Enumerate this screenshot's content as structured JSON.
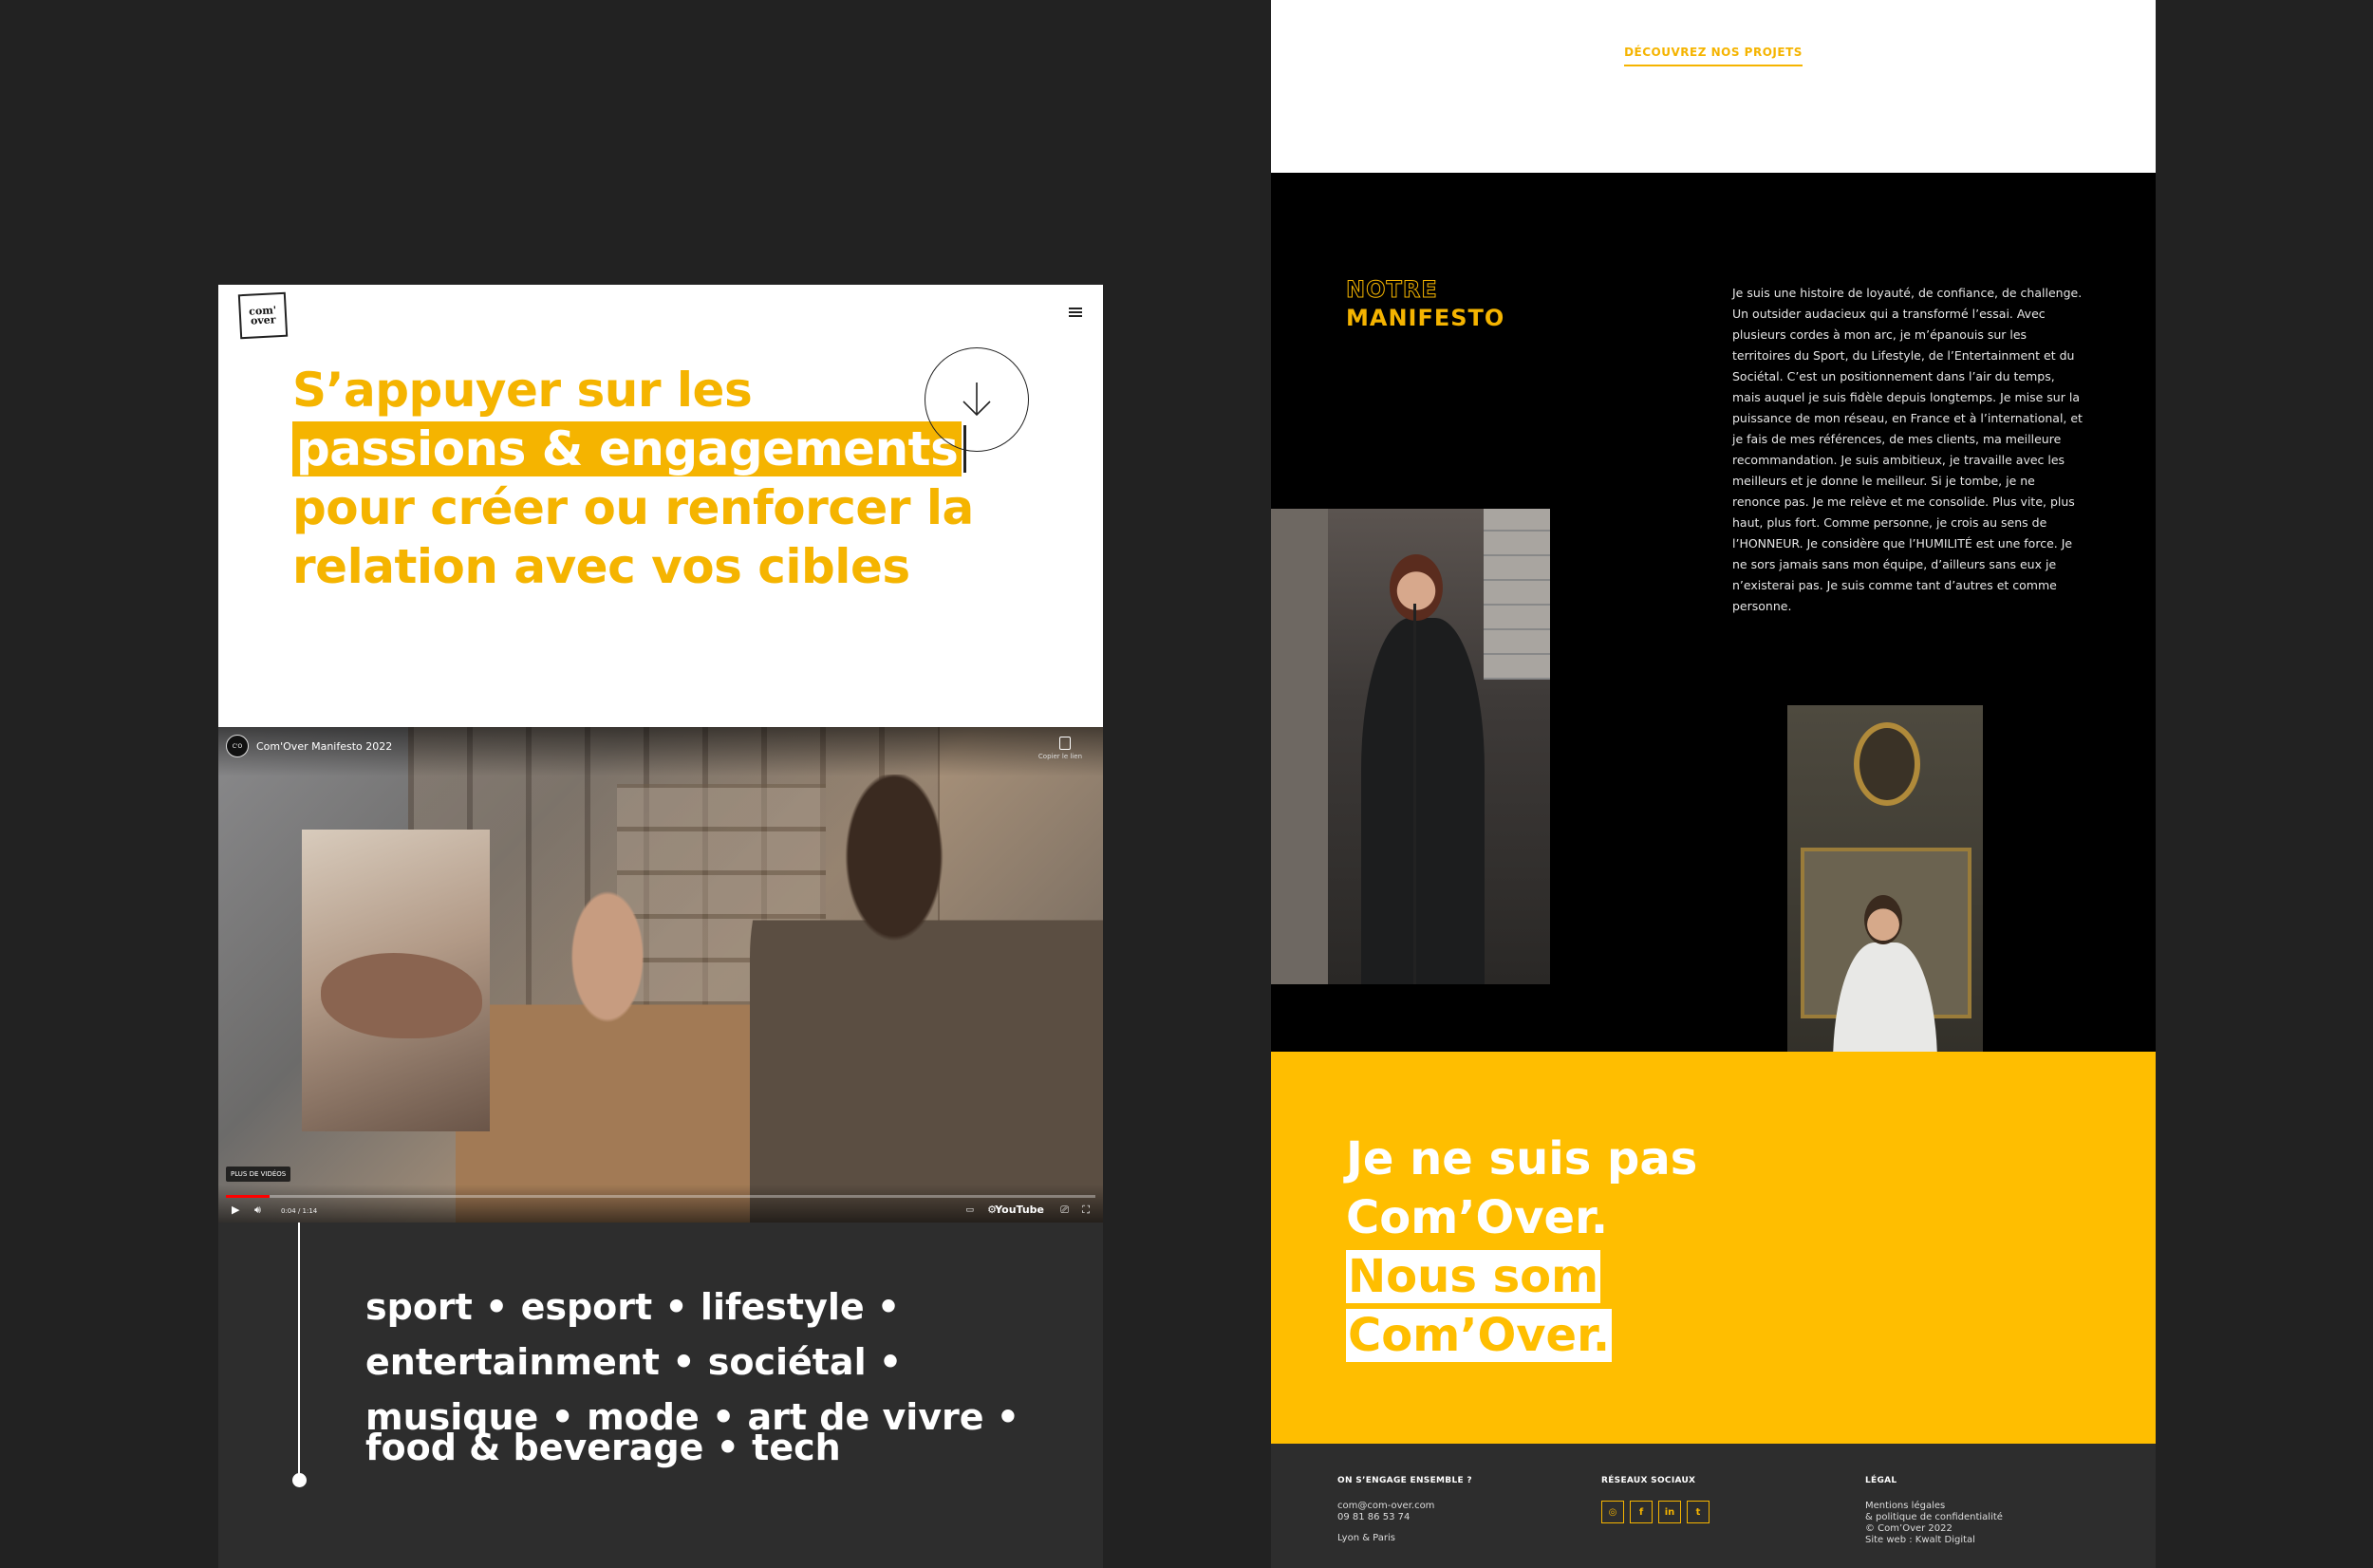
{
  "left_panel": {
    "logo_text": "com' over",
    "hero": {
      "line1": "S’appuyer sur les",
      "line2_highlight": "passions & engagements",
      "line3": "pour créer ou renforcer la",
      "line4": "relation avec vos cibles"
    },
    "video": {
      "channel_initials": "C'O",
      "title": "Com'Over Manifesto 2022",
      "copy_label": "Copier le lien",
      "more_videos": "PLUS DE VIDÉOS",
      "time": "0:04 / 1:14",
      "progress": 0.05,
      "youtube_label": "YouTube"
    },
    "tags": {
      "line1": "sport • esport • lifestyle •",
      "line2": "entertainment • sociétal •",
      "line3": "musique • mode • art de vivre •",
      "line4": "food & beverage • tech"
    }
  },
  "right_panel": {
    "discover_link": "DÉCOUVREZ NOS PROJETS",
    "manifesto": {
      "title_outline": "NOTRE",
      "title_fill": "MANIFESTO",
      "text": "Je suis une histoire de loyauté, de confiance, de challenge. Un outsider audacieux qui a transformé l’essai. Avec plusieurs cordes à mon arc, je m’épanouis sur les territoires du Sport, du Lifestyle, de l’Entertainment et du Sociétal. C’est un positionnement dans l’air du temps, mais auquel je suis fidèle depuis longtemps. Je mise sur la puissance de mon réseau, en France et à l’international, et je fais de mes références, de mes clients, ma meilleure recommandation. Je suis ambitieux, je travaille avec les meilleurs et je donne le meilleur. Si je tombe, je ne renonce pas. Je me relève et me consolide. Plus vite, plus haut, plus fort. Comme personne, je crois au sens de l’HONNEUR. Je considère que l’HUMILITÉ est une force. Je ne sors jamais sans mon équipe, d’ailleurs sans eux je n’existerai pas. Je suis comme tant d’autres et comme personne."
    },
    "cta": {
      "line1": "Je ne suis pas",
      "line2": "Com’Over.",
      "line3_highlight": "Nous som",
      "line4_highlight": "Com’Over."
    },
    "footer": {
      "col1": {
        "heading": "ON S’ENGAGE ENSEMBLE ?",
        "email": "com@com-over.com",
        "phone": "09 81 86 53 74",
        "city": "Lyon & Paris"
      },
      "col2": {
        "heading": "RÉSEAUX SOCIAUX",
        "icons": [
          "instagram-icon",
          "facebook-icon",
          "linkedin-icon",
          "twitter-icon"
        ]
      },
      "col3": {
        "heading": "LÉGAL",
        "link1": "Mentions légales",
        "link2": "& politique de confidentialité",
        "copyright": "© Com’Over 2022",
        "credit": "Site web : Kwalt Digital"
      }
    }
  },
  "colors": {
    "accent": "#ffbe00",
    "dark": "#2d2d2d",
    "background": "#222222"
  }
}
